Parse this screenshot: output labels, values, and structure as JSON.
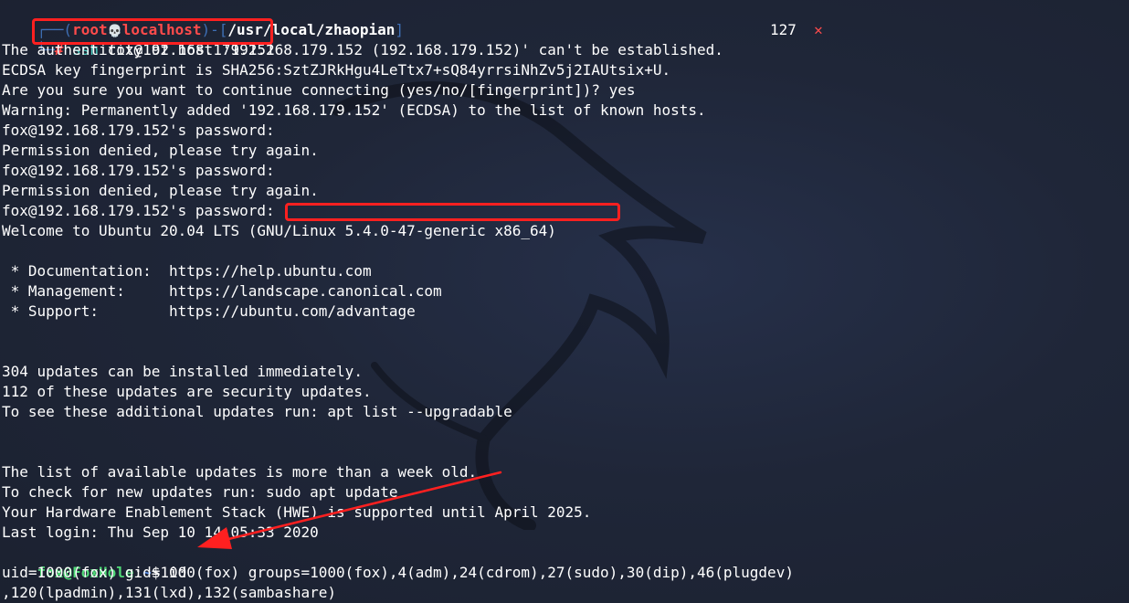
{
  "prompt": {
    "frame_top": "┌──(",
    "user": "root",
    "skull": "💀",
    "host": "localhost",
    "frame_mid": ")-[",
    "path": "/usr/local/zhaopian",
    "frame_end": "]",
    "frame_bottom": "└─",
    "hash": "#",
    "command_name": "ssh",
    "command_args": " fox@192.168.179.152",
    "exit_code": "127",
    "exit_mark": "✕"
  },
  "output_lines": [
    "The authenticity of host '192.168.179.152 (192.168.179.152)' can't be established.",
    "ECDSA key fingerprint is SHA256:SztZJRkHgu4LeTtx7+sQ84yrrsiNhZv5j2IAUtsix+U.",
    "Are you sure you want to continue connecting (yes/no/[fingerprint])? yes",
    "Warning: Permanently added '192.168.179.152' (ECDSA) to the list of known hosts.",
    "fox@192.168.179.152's password:",
    "Permission denied, please try again.",
    "fox@192.168.179.152's password:",
    "Permission denied, please try again.",
    "fox@192.168.179.152's password:",
    "Welcome to Ubuntu 20.04 LTS (GNU/Linux 5.4.0-47-generic x86_64)",
    "",
    " * Documentation:  https://help.ubuntu.com",
    " * Management:     https://landscape.canonical.com",
    " * Support:        https://ubuntu.com/advantage",
    "",
    "",
    "304 updates can be installed immediately.",
    "112 of these updates are security updates.",
    "To see these additional updates run: apt list --upgradable",
    "",
    "",
    "The list of available updates is more than a week old.",
    "To check for new updates run: sudo apt update",
    "Your Hardware Enablement Stack (HWE) is supported until April 2025.",
    "Last login: Thu Sep 10 14:05:33 2020"
  ],
  "fox_prompt": {
    "user_host": "fox@FoxHole",
    "colon": ":",
    "path": "~",
    "dollar": "$ ",
    "command": "id"
  },
  "id_output": [
    "uid=1000(fox) gid=1000(fox) groups=1000(fox),4(adm),24(cdrom),27(sudo),30(dip),46(plugdev)",
    ",120(lpadmin),131(lxd),132(sambashare)"
  ],
  "colors": {
    "background": "#1c2230",
    "annotation": "#ff2020",
    "prompt_red": "#ff4b4b",
    "prompt_frame": "#3e6fb5",
    "fox_green": "#4fd977",
    "path_blue": "#5b8fe8",
    "ssh_cyan": "#4fd1c5"
  }
}
